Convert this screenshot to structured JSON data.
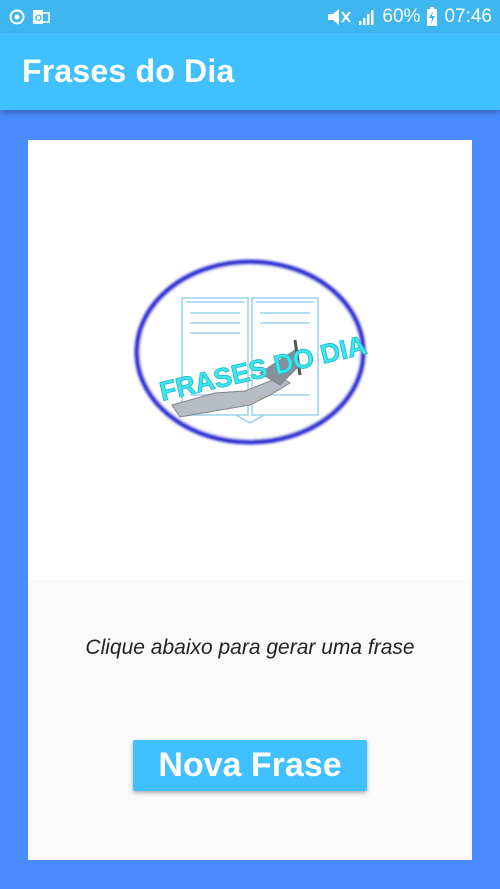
{
  "status_bar": {
    "battery": "60%",
    "time": "07:46",
    "icons": [
      "sync-icon",
      "outlook-icon",
      "mute-icon",
      "signal-icon",
      "battery-charging-icon"
    ]
  },
  "app_bar": {
    "title": "Frases do Dia"
  },
  "logo": {
    "text": "FRASES DO DIA"
  },
  "main": {
    "prompt": "Clique abaixo para gerar uma frase",
    "button_label": "Nova Frase"
  },
  "colors": {
    "accent": "#40c0ff",
    "status_bar": "#3fb6f0",
    "background": "#4a8bff",
    "logo_ring": "#2a2ad4",
    "logo_text": "#3ee6f0"
  }
}
